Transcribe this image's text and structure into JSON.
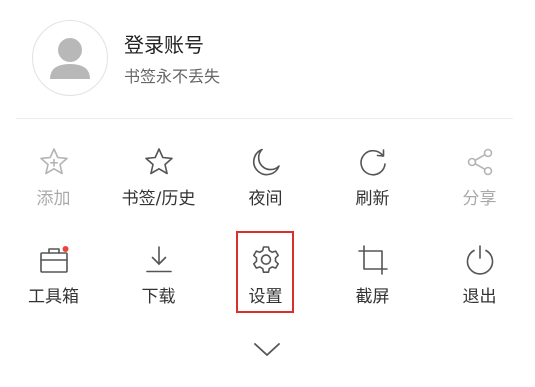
{
  "account": {
    "title": "登录账号",
    "subtitle": "书签永不丢失"
  },
  "menu": {
    "row1": [
      {
        "label": "添加",
        "icon": "star-plus-icon",
        "enabled": false
      },
      {
        "label": "书签/历史",
        "icon": "star-icon",
        "enabled": true
      },
      {
        "label": "夜间",
        "icon": "moon-icon",
        "enabled": true
      },
      {
        "label": "刷新",
        "icon": "refresh-icon",
        "enabled": true
      },
      {
        "label": "分享",
        "icon": "share-icon",
        "enabled": false
      }
    ],
    "row2": [
      {
        "label": "工具箱",
        "icon": "toolbox-icon",
        "badge": true
      },
      {
        "label": "下载",
        "icon": "download-icon"
      },
      {
        "label": "设置",
        "icon": "gear-icon",
        "highlighted": true
      },
      {
        "label": "截屏",
        "icon": "crop-icon"
      },
      {
        "label": "退出",
        "icon": "power-icon"
      }
    ]
  },
  "collapse_icon": "chevron-down-icon",
  "colors": {
    "highlight": "#d9302c",
    "badge": "#e8453c",
    "disabled": "#aaaaaa"
  }
}
